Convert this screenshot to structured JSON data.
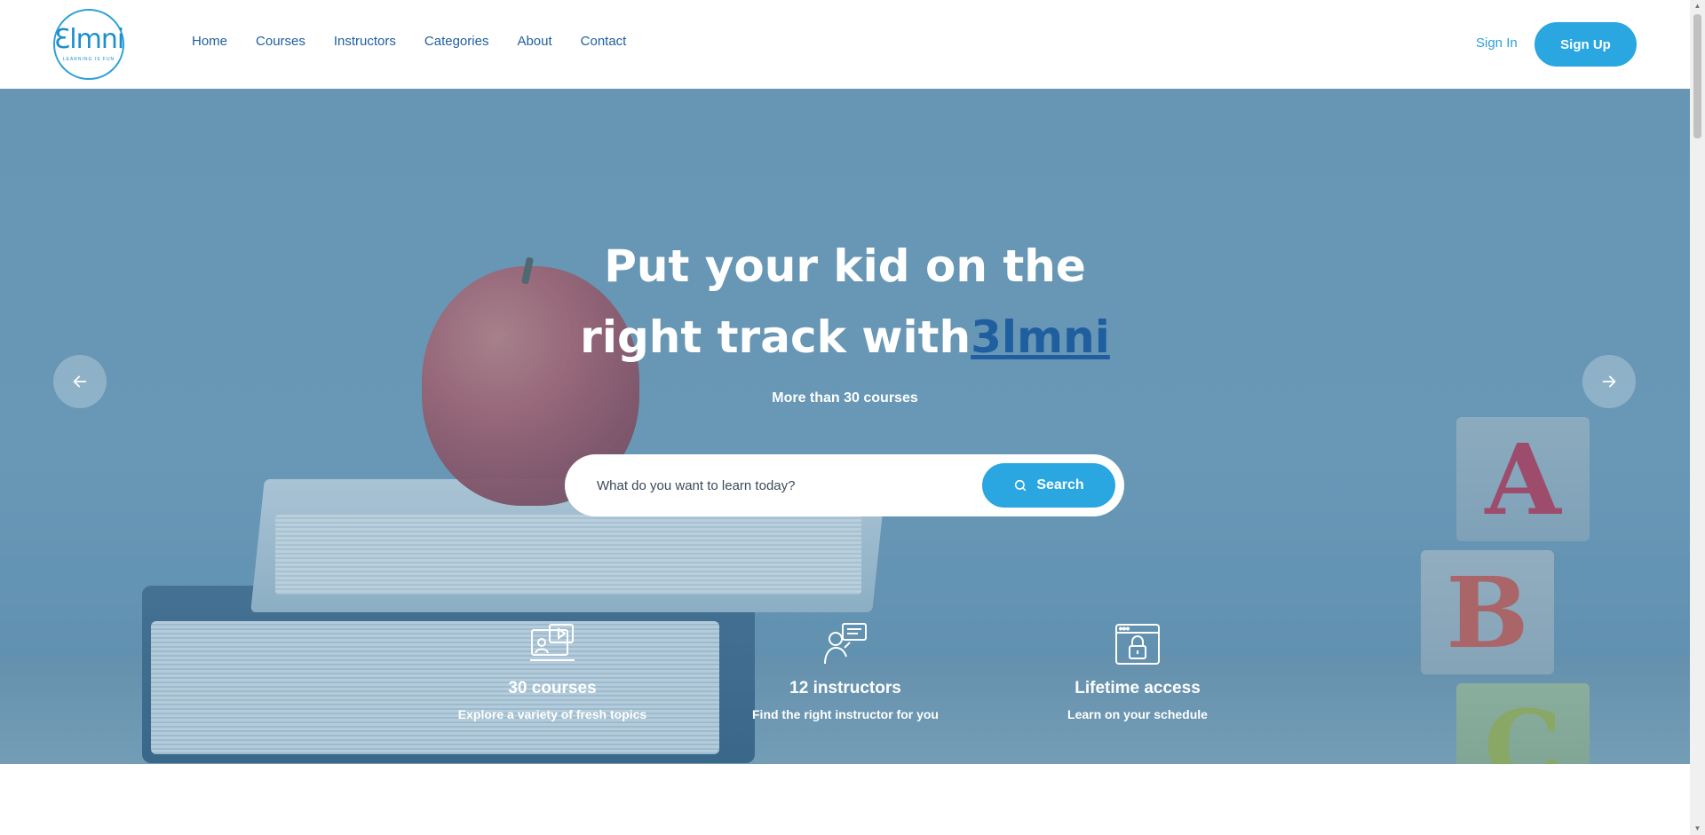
{
  "header": {
    "logo": {
      "mark": "Ɛlmni",
      "tagline": "LEARNING IS FUN"
    },
    "nav": [
      "Home",
      "Courses",
      "Instructors",
      "Categories",
      "About",
      "Contact"
    ],
    "sign_in": "Sign In",
    "sign_up": "Sign Up"
  },
  "hero": {
    "headline_line1": "Put your kid on the",
    "headline_line2": "right track with",
    "brand": "3lmni",
    "subtext": "More than 30 courses",
    "search": {
      "placeholder": "What do you want to learn today?",
      "button": "Search"
    },
    "features": [
      {
        "icon": "video-lesson-icon",
        "title": "30 courses",
        "desc": "Explore a variety of fresh topics"
      },
      {
        "icon": "instructor-icon",
        "title": "12 instructors",
        "desc": "Find the right instructor for you"
      },
      {
        "icon": "lifetime-lock-icon",
        "title": "Lifetime access",
        "desc": "Learn on your schedule"
      }
    ],
    "blocks": [
      "A",
      "B",
      "C"
    ]
  },
  "colors": {
    "accent": "#2aa6e0",
    "nav_text": "#1f5fa0",
    "brand_link": "#1f5fa0"
  }
}
